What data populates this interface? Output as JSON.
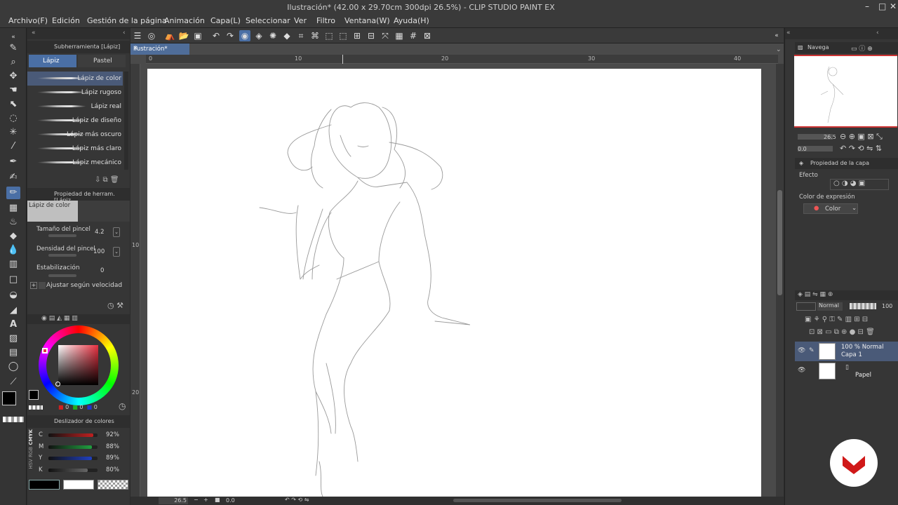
{
  "window": {
    "title": "Ilustración* (42.00 x 29.70cm 300dpi 26.5%)  - CLIP STUDIO PAINT EX"
  },
  "menu": [
    "Archivo(F)",
    "Edición",
    "Gestión de la página",
    "Animación",
    "Capa(L)",
    "Seleccionar",
    "Ver",
    "Filtro",
    "Ventana(W)",
    "Ayuda(H)"
  ],
  "subtool": {
    "header": "Subherramienta [Lápiz]",
    "tab_active": "Lápiz",
    "tab2": "Pastel",
    "brushes": [
      "Lápiz de color",
      "Lápiz rugoso",
      "Lápiz real",
      "Lápiz de diseño",
      "Lápiz más oscuro",
      "Lápiz más claro",
      "Lápiz mecánico"
    ]
  },
  "toolprop": {
    "header": "Propiedad de herram. [Lápiz",
    "preset": "Lápiz de color",
    "size_label": "Tamaño del pincel",
    "size_value": "4.2",
    "density_label": "Densidad del pincel",
    "density_value": "100",
    "stab_label": "Estabilización",
    "stab_value": "0",
    "speed_label": "Ajustar según velocidad"
  },
  "colorwheel": {
    "r": "0",
    "g": "0",
    "b": "0"
  },
  "colorslider": {
    "header": "Deslizador de colores",
    "rows": [
      {
        "k": "C",
        "v": "92%",
        "color": "#c02020",
        "fill": 0.92
      },
      {
        "k": "M",
        "v": "88%",
        "color": "#20a040",
        "fill": 0.88
      },
      {
        "k": "Y",
        "v": "89%",
        "color": "#2040c0",
        "fill": 0.89
      },
      {
        "k": "K",
        "v": "80%",
        "color": "#666666",
        "fill": 0.8
      }
    ],
    "modes": "CMYK"
  },
  "document": {
    "tab": "Ilustración*",
    "ruler_h": [
      "0",
      "10",
      "20",
      "30",
      "40"
    ],
    "ruler_v": [
      "10",
      "20"
    ]
  },
  "status": {
    "zoom": "26.5",
    "angle": "0.0"
  },
  "navigator": {
    "header": "Navega",
    "zoom": "26.5",
    "angle": "0.0"
  },
  "layerprop": {
    "header": "Propiedad de la capa",
    "effect": "Efecto",
    "expr_label": "Color de expresión",
    "expr_value": "Color"
  },
  "layers": {
    "blend": "Normal",
    "opacity": "100",
    "items": [
      {
        "line1": "100 % Normal",
        "line2": "Capa 1"
      },
      {
        "line1": "Papel",
        "line2": ""
      }
    ]
  }
}
